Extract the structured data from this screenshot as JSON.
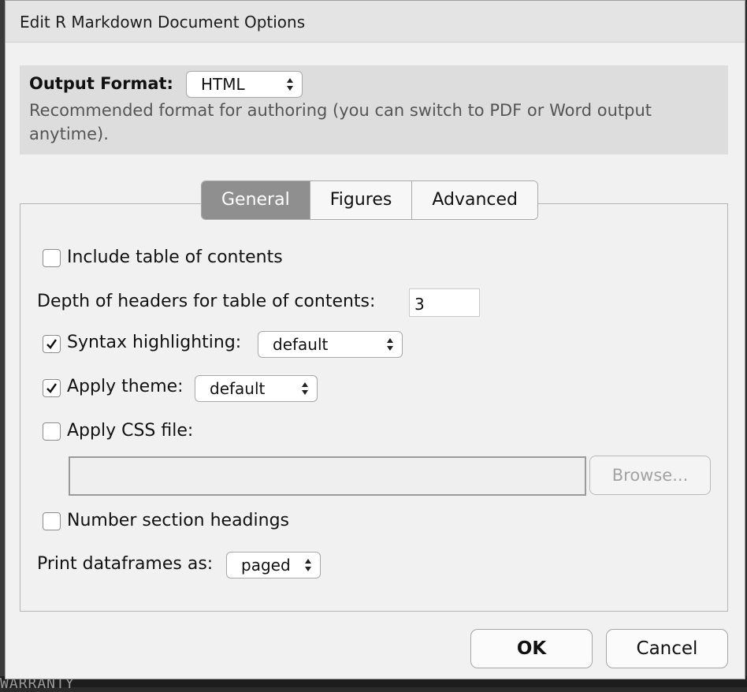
{
  "dialog": {
    "title": "Edit R Markdown Document Options"
  },
  "output": {
    "label": "Output Format:",
    "selected": "HTML",
    "description": "Recommended format for authoring (you can switch to PDF or Word output anytime)."
  },
  "tabs": [
    {
      "label": "General",
      "active": true
    },
    {
      "label": "Figures",
      "active": false
    },
    {
      "label": "Advanced",
      "active": false
    }
  ],
  "general": {
    "toc": {
      "label": "Include table of contents",
      "checked": false
    },
    "toc_depth": {
      "label": "Depth of headers for table of contents:",
      "value": "3"
    },
    "highlight": {
      "label": "Syntax highlighting:",
      "checked": true,
      "selected": "default"
    },
    "theme": {
      "label": "Apply theme:",
      "checked": true,
      "selected": "default"
    },
    "css": {
      "label": "Apply CSS file:",
      "checked": false,
      "value": "",
      "browse_label": "Browse..."
    },
    "number_sections": {
      "label": "Number section headings",
      "checked": false
    },
    "df_print": {
      "label": "Print dataframes as:",
      "selected": "paged"
    }
  },
  "buttons": {
    "ok": "OK",
    "cancel": "Cancel"
  },
  "background": {
    "peek_text": "WARRANTY"
  },
  "colors": {
    "active_tab": "#8f8f8f",
    "dialog_bg": "#f1f1f1",
    "format_panel_bg": "#dddddd"
  }
}
